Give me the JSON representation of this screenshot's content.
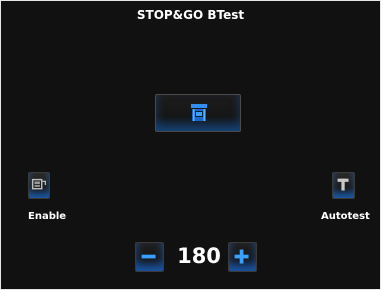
{
  "header": {
    "title": "STOP&GO BTest"
  },
  "main_button": {
    "icon": "machine-icon"
  },
  "enable": {
    "label": "Enable",
    "icon": "printer-icon"
  },
  "autotest": {
    "label": "Autotest",
    "icon": "t-letter-icon"
  },
  "stepper": {
    "value": "180",
    "minus_icon": "minus-icon",
    "plus_icon": "plus-icon"
  },
  "colors": {
    "accent": "#2f8ff0",
    "background": "#111111",
    "text": "#ffffff"
  }
}
